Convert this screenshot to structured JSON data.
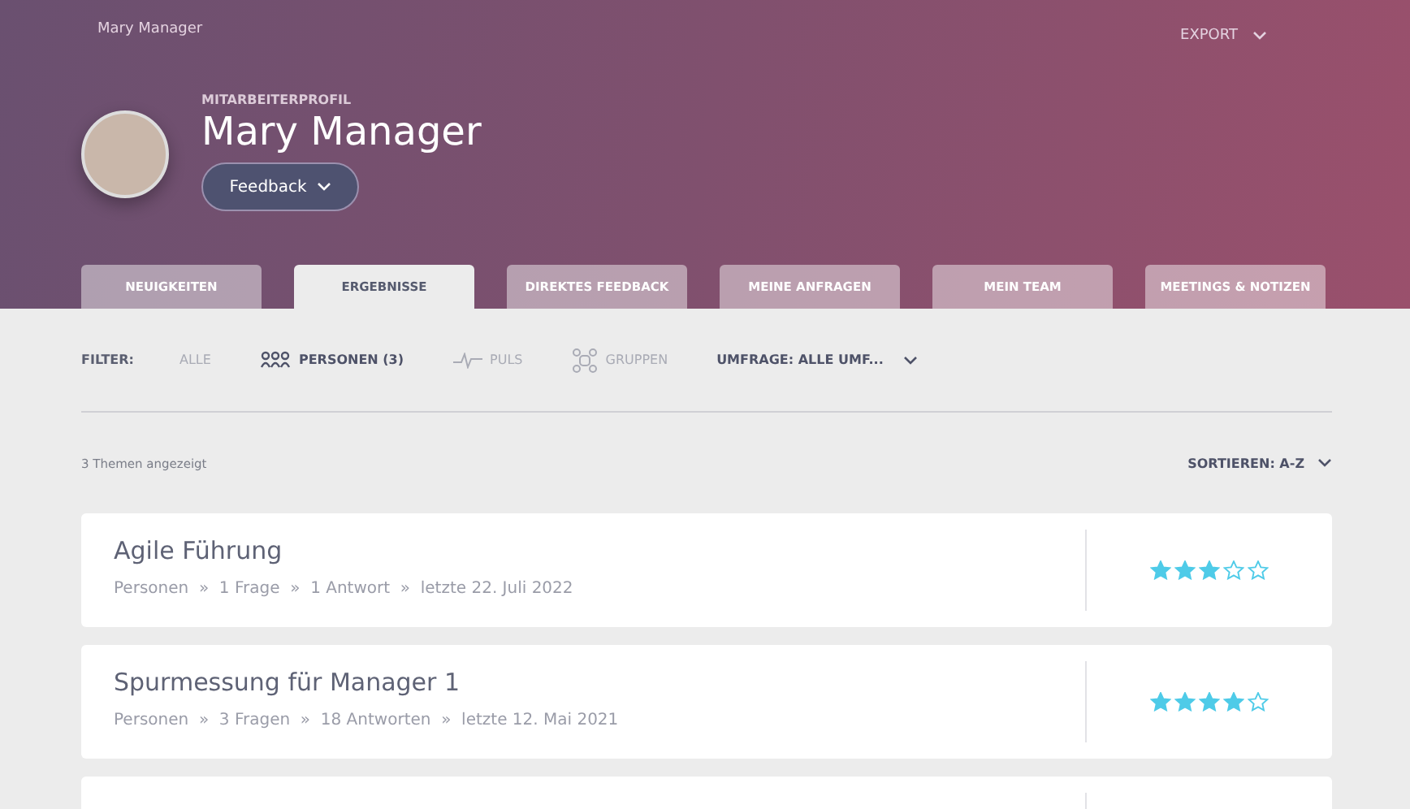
{
  "header": {
    "breadcrumb": "Mary Manager",
    "export": "EXPORT",
    "eyebrow": "MITARBEITERPROFIL",
    "name": "Mary Manager",
    "feedback_button": "Feedback"
  },
  "tabs": [
    {
      "label": "NEUIGKEITEN",
      "selected": false
    },
    {
      "label": "ERGEBNISSE",
      "selected": true
    },
    {
      "label": "DIREKTES FEEDBACK",
      "selected": false
    },
    {
      "label": "MEINE ANFRAGEN",
      "selected": false
    },
    {
      "label": "MEIN TEAM",
      "selected": false
    },
    {
      "label": "MEETINGS & NOTIZEN",
      "selected": false
    }
  ],
  "filter": {
    "label": "FILTER:",
    "items": [
      {
        "kind": "all",
        "label": "ALLE",
        "selected": false
      },
      {
        "kind": "people",
        "label": "PERSONEN (3)",
        "selected": true
      },
      {
        "kind": "pulse",
        "label": "PULS",
        "selected": false
      },
      {
        "kind": "groups",
        "label": "GRUPPEN",
        "selected": false
      }
    ],
    "survey": "UMFRAGE: ALLE UMF..."
  },
  "count": "3 Themen angezeigt",
  "sort": "SORTIEREN: A-Z",
  "topics": [
    {
      "title": "Agile Führung",
      "meta": "Personen  »  1 Frage  »  1 Antwort  »  letzte 22. Juli 2022",
      "stars": 3
    },
    {
      "title": "Spurmessung für Manager 1",
      "meta": "Personen  »  3 Fragen  »  18 Antworten  »  letzte 12. Mai 2021",
      "stars": 4
    }
  ],
  "list_continues": true
}
